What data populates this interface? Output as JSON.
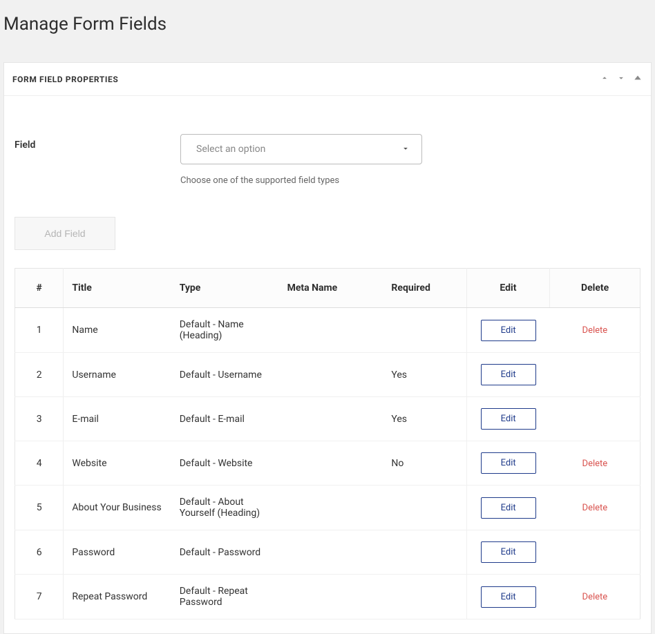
{
  "page": {
    "title": "Manage Form Fields"
  },
  "panel": {
    "title": "FORM FIELD PROPERTIES"
  },
  "field_selector": {
    "label": "Field",
    "placeholder": "Select an option",
    "helper": "Choose one of the supported field types"
  },
  "buttons": {
    "add_field": "Add Field",
    "edit": "Edit",
    "delete": "Delete"
  },
  "table": {
    "headers": {
      "num": "#",
      "title": "Title",
      "type": "Type",
      "meta": "Meta Name",
      "required": "Required",
      "edit": "Edit",
      "delete": "Delete"
    },
    "rows": [
      {
        "num": "1",
        "title": "Name",
        "type": "Default - Name (Heading)",
        "meta": "",
        "required": "",
        "deletable": true
      },
      {
        "num": "2",
        "title": "Username",
        "type": "Default - Username",
        "meta": "",
        "required": "Yes",
        "deletable": false
      },
      {
        "num": "3",
        "title": "E-mail",
        "type": "Default - E-mail",
        "meta": "",
        "required": "Yes",
        "deletable": false
      },
      {
        "num": "4",
        "title": "Website",
        "type": "Default - Website",
        "meta": "",
        "required": "No",
        "deletable": true
      },
      {
        "num": "5",
        "title": "About Your Business",
        "type": "Default - About Yourself (Heading)",
        "meta": "",
        "required": "",
        "deletable": true
      },
      {
        "num": "6",
        "title": "Password",
        "type": "Default - Password",
        "meta": "",
        "required": "",
        "deletable": false
      },
      {
        "num": "7",
        "title": "Repeat Password",
        "type": "Default - Repeat Password",
        "meta": "",
        "required": "",
        "deletable": true
      }
    ]
  }
}
